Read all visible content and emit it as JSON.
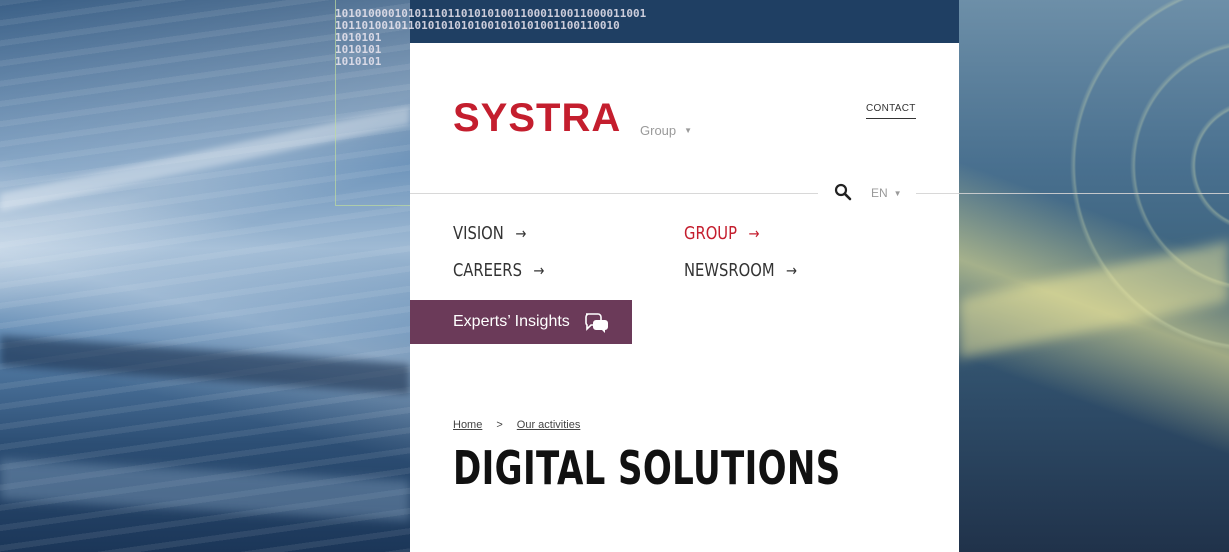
{
  "background": {
    "binary_lines": [
      "10101000010101110110101010011000110011000011001",
      "1011010010110101010101001010101001100110010",
      "1010101",
      "1010101",
      "1010101"
    ]
  },
  "header": {
    "logo_text": "SYSTRA",
    "group_label": "Group",
    "contact_label": "CONTACT",
    "language": "EN"
  },
  "nav": {
    "items": [
      {
        "label": "VISION",
        "arrow": "→"
      },
      {
        "label": "GROUP",
        "arrow": "→"
      },
      {
        "label": "CAREERS",
        "arrow": "→"
      },
      {
        "label": "NEWSROOM",
        "arrow": "→"
      }
    ],
    "active": "GROUP"
  },
  "insights": {
    "label": "Experts’ Insights"
  },
  "breadcrumb": {
    "home": "Home",
    "separator": ">",
    "current": "Our activities"
  },
  "page": {
    "title": "DIGITAL SOLUTIONS"
  },
  "colors": {
    "brand_red": "#c41e2e",
    "insights_purple": "#6b3a59",
    "text_dark": "#111111",
    "muted": "#9a9a9a"
  },
  "icons": {
    "search": "search-icon",
    "chat": "chat-bubbles-icon",
    "caret": "caret-down-icon",
    "arrow": "arrow-right-icon"
  }
}
